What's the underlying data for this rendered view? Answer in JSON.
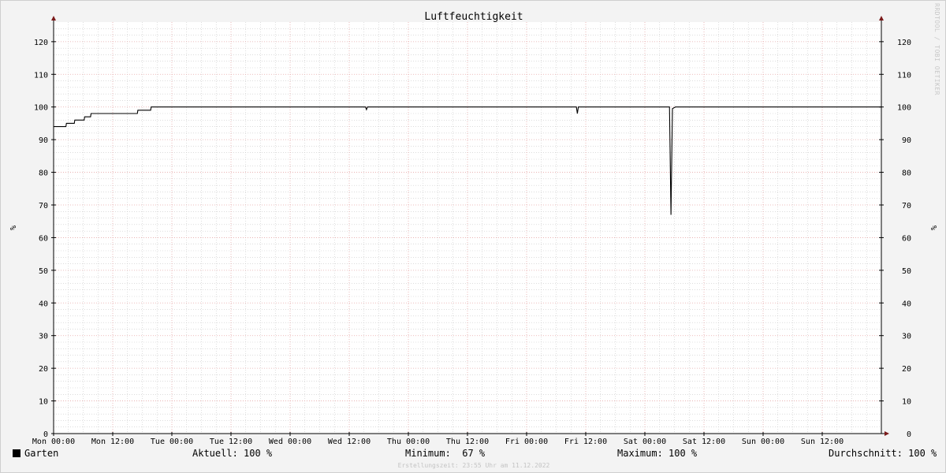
{
  "chart_data": {
    "type": "line",
    "title": "Luftfeuchtigkeit",
    "ylabel": "%",
    "ylim": [
      0,
      126
    ],
    "yticks": [
      0,
      10,
      20,
      30,
      40,
      50,
      60,
      70,
      80,
      90,
      100,
      110,
      120
    ],
    "xlim": [
      0,
      168
    ],
    "xticks": [
      {
        "t": 0,
        "label": "Mon 00:00"
      },
      {
        "t": 12,
        "label": "Mon 12:00"
      },
      {
        "t": 24,
        "label": "Tue 00:00"
      },
      {
        "t": 36,
        "label": "Tue 12:00"
      },
      {
        "t": 48,
        "label": "Wed 00:00"
      },
      {
        "t": 60,
        "label": "Wed 12:00"
      },
      {
        "t": 72,
        "label": "Thu 00:00"
      },
      {
        "t": 84,
        "label": "Thu 12:00"
      },
      {
        "t": 96,
        "label": "Fri 00:00"
      },
      {
        "t": 108,
        "label": "Fri 12:00"
      },
      {
        "t": 120,
        "label": "Sat 00:00"
      },
      {
        "t": 132,
        "label": "Sat 12:00"
      },
      {
        "t": 144,
        "label": "Sun 00:00"
      },
      {
        "t": 156,
        "label": "Sun 12:00"
      }
    ],
    "grid": true,
    "colors": {
      "line": "#000000",
      "major_grid": "#e6a8a8",
      "minor_grid": "#c8c8c8",
      "axis": "#000000",
      "arrow": "#7a1a1a"
    },
    "series": [
      {
        "name": "Garten",
        "points": [
          [
            0,
            94
          ],
          [
            2.5,
            94
          ],
          [
            2.6,
            95
          ],
          [
            4.2,
            95
          ],
          [
            4.3,
            96
          ],
          [
            6.2,
            96
          ],
          [
            6.3,
            97
          ],
          [
            7.5,
            97
          ],
          [
            7.6,
            98
          ],
          [
            17,
            98
          ],
          [
            17.1,
            99
          ],
          [
            19.7,
            99
          ],
          [
            19.8,
            100
          ],
          [
            63.3,
            100
          ],
          [
            63.5,
            99.2
          ],
          [
            63.7,
            100
          ],
          [
            106.1,
            100
          ],
          [
            106.3,
            98
          ],
          [
            106.5,
            100
          ],
          [
            125,
            100
          ],
          [
            125.3,
            67
          ],
          [
            125.6,
            99.5
          ],
          [
            126.2,
            100
          ],
          [
            168,
            100
          ]
        ]
      }
    ]
  },
  "legend": {
    "series_name": "Garten",
    "current": "Aktuell: 100 %",
    "minimum": "Minimum:  67 %",
    "maximum": "Maximum: 100 %",
    "average": "Durchschnitt: 100 %"
  },
  "footer": "Erstellungszeit: 23:55 Uhr am 11.12.2022",
  "watermark": "RRDTOOL / TOBI OETIKER"
}
